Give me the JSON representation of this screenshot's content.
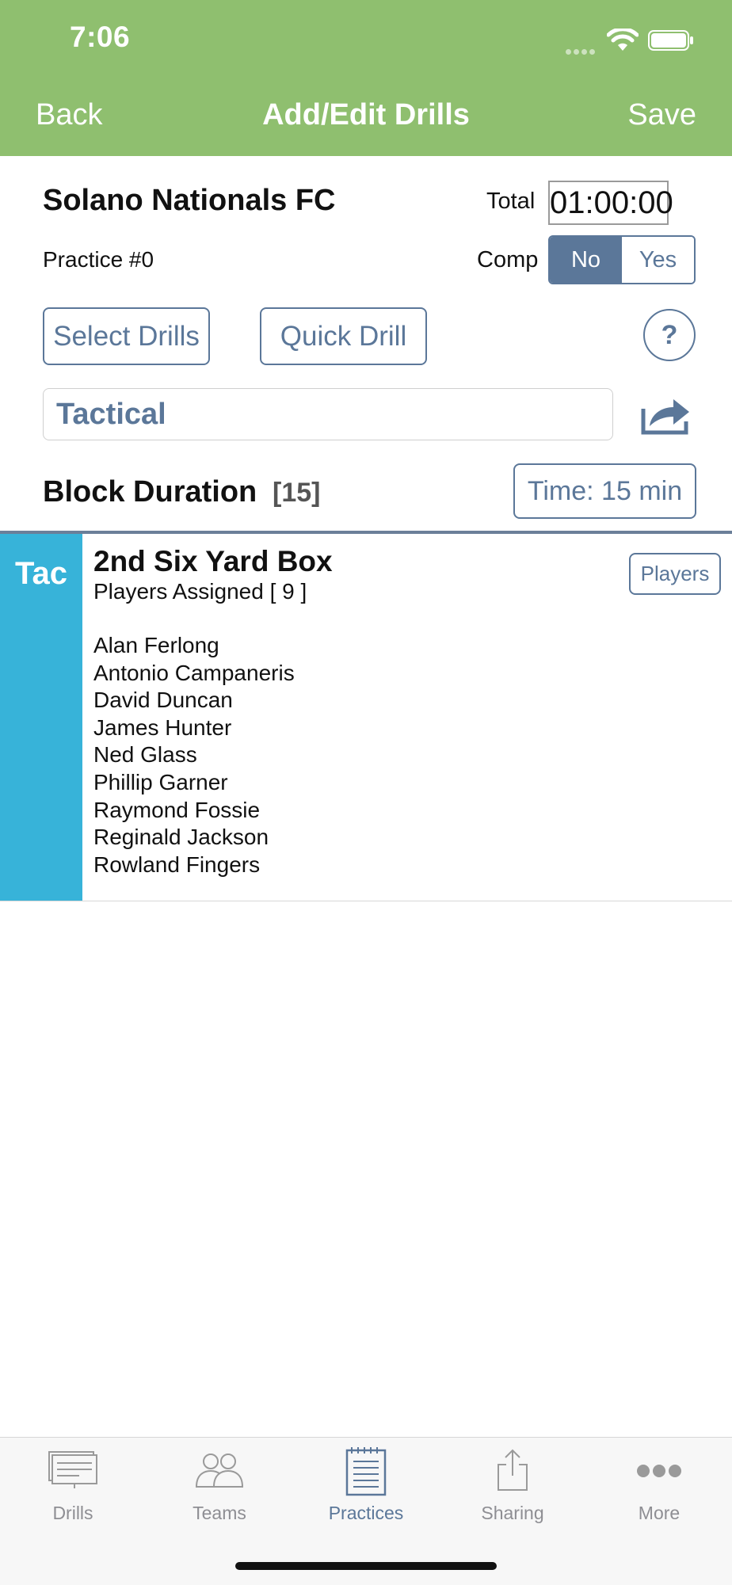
{
  "status_bar": {
    "time": "7:06"
  },
  "nav": {
    "back_label": "Back",
    "title": "Add/Edit Drills",
    "save_label": "Save"
  },
  "practice": {
    "team_name": "Solano Nationals FC",
    "total_label": "Total",
    "total_time": "01:00:00",
    "practice_number": "Practice #0",
    "comp_label": "Comp",
    "comp_options": {
      "no": "No",
      "yes": "Yes"
    },
    "comp_selected": "No"
  },
  "actions": {
    "select_drills_label": "Select Drills",
    "quick_drill_label": "Quick Drill",
    "help_label": "?"
  },
  "category": {
    "value": "Tactical"
  },
  "block": {
    "label": "Block Duration",
    "value": "[15]",
    "time_button_label": "Time: 15 min"
  },
  "drill": {
    "tag": "Tac",
    "tag_color": "#37b3d9",
    "title": "2nd Six Yard Box",
    "players_assigned": "Players Assigned [ 9 ]",
    "players_button_label": "Players",
    "players": [
      "Alan Ferlong",
      "Antonio Campaneris",
      "David Duncan",
      "James Hunter",
      "Ned Glass",
      "Phillip Garner",
      "Raymond Fossie",
      "Reginald Jackson",
      "Rowland Fingers"
    ]
  },
  "tabbar": {
    "tabs": [
      {
        "label": "Drills",
        "icon": "drills-icon"
      },
      {
        "label": "Teams",
        "icon": "teams-icon"
      },
      {
        "label": "Practices",
        "icon": "practices-icon",
        "active": true
      },
      {
        "label": "Sharing",
        "icon": "share-icon"
      },
      {
        "label": "More",
        "icon": "more-icon"
      }
    ]
  },
  "colors": {
    "header_green": "#8fbf6f",
    "accent_blue": "#5b7799",
    "tag_blue": "#37b3d9"
  }
}
